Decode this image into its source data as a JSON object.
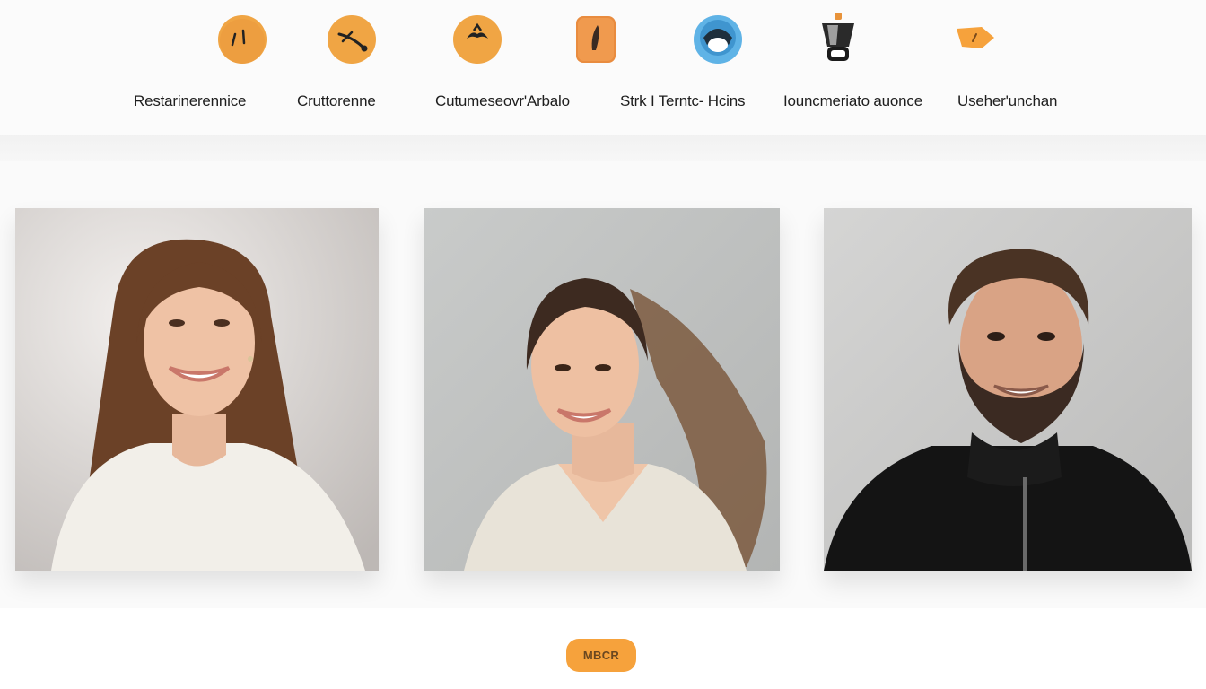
{
  "nav": {
    "items": [
      {
        "label": "Restarinerennice",
        "icon": "smiley-face-icon"
      },
      {
        "label": "Cruttorenne",
        "icon": "tools-icon"
      },
      {
        "label": "Cutumeseovr'Arbalo",
        "icon": "mustache-face-icon"
      },
      {
        "label": "Strk I Terntc- Hcins",
        "icon": "feather-tag-icon"
      },
      {
        "label": "Iouncmeriato auonce",
        "icon": "headset-icon"
      },
      {
        "label": "Useher'unchan",
        "icon": "tag-icon"
      }
    ]
  },
  "gallery": {
    "photos": [
      {
        "name": "portrait-woman-long-hair"
      },
      {
        "name": "portrait-woman-ponytail"
      },
      {
        "name": "portrait-man-beard"
      }
    ]
  },
  "more_button": {
    "label": "MBCR"
  },
  "colors": {
    "accent": "#f6a23c",
    "icon_blue": "#5fb3e6",
    "background": "#fafafa"
  }
}
